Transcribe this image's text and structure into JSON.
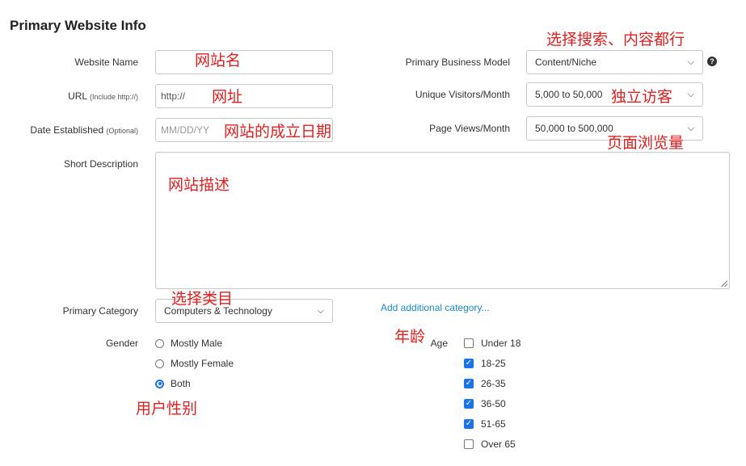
{
  "section_title": "Primary Website Info",
  "fields": {
    "website_name": {
      "label": "Website Name",
      "value": ""
    },
    "url": {
      "label": "URL",
      "hint": "(Include http://)",
      "value": "http://"
    },
    "date_established": {
      "label": "Date Established",
      "hint": "(Optional)",
      "placeholder": "MM/DD/YY"
    },
    "short_description": {
      "label": "Short Description",
      "value": ""
    },
    "primary_category": {
      "label": "Primary Category",
      "selected": "Computers & Technology"
    },
    "add_category_link": "Add additional category...",
    "primary_business_model": {
      "label": "Primary Business Model",
      "selected": "Content/Niche"
    },
    "unique_visitors": {
      "label": "Unique Visitors/Month",
      "selected": "5,000 to 50,000"
    },
    "page_views": {
      "label": "Page Views/Month",
      "selected": "50,000 to 500,000"
    }
  },
  "gender": {
    "label": "Gender",
    "options": [
      {
        "label": "Mostly Male",
        "checked": false
      },
      {
        "label": "Mostly Female",
        "checked": false
      },
      {
        "label": "Both",
        "checked": true
      }
    ]
  },
  "age": {
    "label": "Age",
    "options": [
      {
        "label": "Under 18",
        "checked": false
      },
      {
        "label": "18-25",
        "checked": true
      },
      {
        "label": "26-35",
        "checked": true
      },
      {
        "label": "36-50",
        "checked": true
      },
      {
        "label": "51-65",
        "checked": true
      },
      {
        "label": "Over 65",
        "checked": false
      }
    ]
  },
  "help_icon": "?",
  "annotations": {
    "website_name": "网站名",
    "url": "网址",
    "date": "网站的成立日期",
    "description": "网站描述",
    "category": "选择类目",
    "gender": "用户性别",
    "age": "年龄",
    "business_model": "选择搜索、内容都行",
    "visitors": "独立访客",
    "page_views": "页面浏览量"
  },
  "colors": {
    "annotation": "#e02020",
    "link": "#1a8ac6",
    "check": "#1a73e8"
  }
}
